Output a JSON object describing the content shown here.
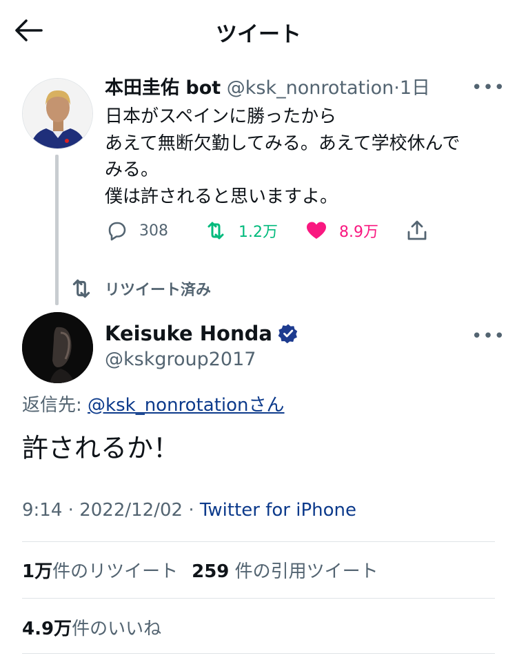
{
  "header": {
    "title": "ツイート"
  },
  "quoted_tweet": {
    "author_name": "本田圭佑 bot",
    "handle": "@ksk_nonrotation",
    "separator": "·",
    "time": "1日",
    "text_lines": [
      "日本がスペインに勝ったから",
      "あえて無断欠勤してみる。あえて学校休んで",
      "みる。",
      "僕は許されると思いますよ。"
    ],
    "reply_count": "308",
    "retweet_count": "1.2万",
    "like_count": "8.9万",
    "colors": {
      "retweet": "#00ba7c",
      "like": "#f91880"
    }
  },
  "retweet_indicator": {
    "label": "リツイート済み"
  },
  "main_tweet": {
    "author_name": "Keisuke Honda",
    "handle": "@kskgroup2017",
    "reply_prefix": "返信先: ",
    "reply_handle": "@ksk_nonrotation",
    "reply_suffix": "さん",
    "text": "許されるか！",
    "time": "9:14",
    "date": "2022/12/02",
    "meta_sep": "·",
    "client": "Twitter for iPhone",
    "retweets_num": "1万",
    "retweets_label": "件のリツイート",
    "quotes_num": "259",
    "quotes_label": "件の引用ツイート",
    "likes_num": "4.9万",
    "likes_label": "件のいいね",
    "colors": {
      "verified": "#1d3b8f",
      "link": "#0c3a8b"
    }
  }
}
